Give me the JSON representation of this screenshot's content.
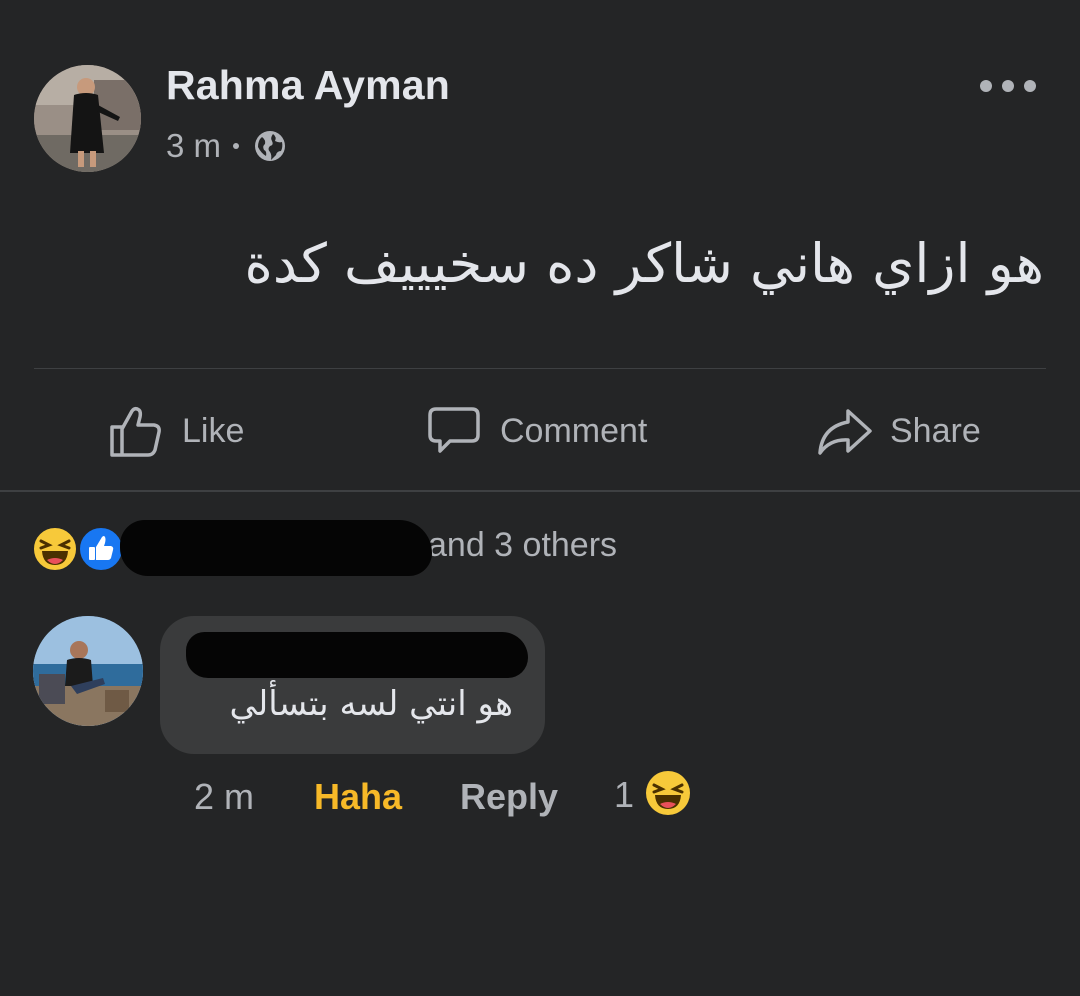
{
  "post": {
    "author": "Rahma Ayman",
    "time": "3 m",
    "audience_icon": "globe-icon",
    "more_icon": "more-options-icon",
    "text": "هو ازاي هاني شاكر ده سخيييف كدة"
  },
  "actions": {
    "like_label": "Like",
    "comment_label": "Comment",
    "share_label": "Share"
  },
  "reactions": {
    "icons": [
      "haha-reaction-icon",
      "like-reaction-icon"
    ],
    "summary_suffix": "and 3 others"
  },
  "comment": {
    "text": "هو انتي لسه بتسألي",
    "time": "2 m",
    "reaction_label": "Haha",
    "reply_label": "Reply",
    "reaction_count": "1",
    "reaction_icon": "haha-reaction-icon"
  },
  "colors": {
    "background": "#242526",
    "bubble": "#3a3b3c",
    "primary_text": "#e4e6eb",
    "secondary_text": "#b0b3b8",
    "haha_active": "#f7b928",
    "like_blue": "#1877f2"
  }
}
